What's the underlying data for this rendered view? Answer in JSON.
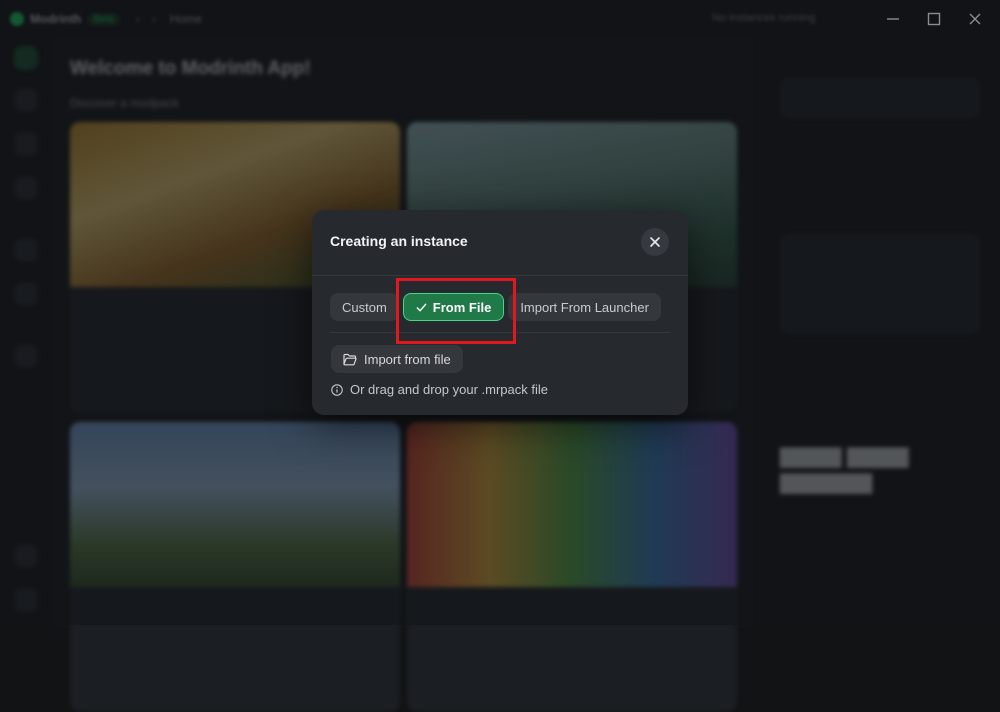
{
  "background": {
    "brand": "Modrinth",
    "brand_badge": "Beta",
    "breadcrumb": "Home",
    "run_status": "No instances running",
    "welcome": "Welcome to Modrinth App!",
    "discover": "Discover a modpack"
  },
  "modal": {
    "title": "Creating an instance",
    "tabs": [
      {
        "label": "Custom"
      },
      {
        "label": "From File"
      },
      {
        "label": "Import From Launcher"
      }
    ],
    "import_button": "Import from file",
    "hint": "Or drag and drop your .mrpack file"
  },
  "colors": {
    "accent": "#1bd96a",
    "active_tab": "#1f7a47",
    "highlight": "#e0191f"
  }
}
